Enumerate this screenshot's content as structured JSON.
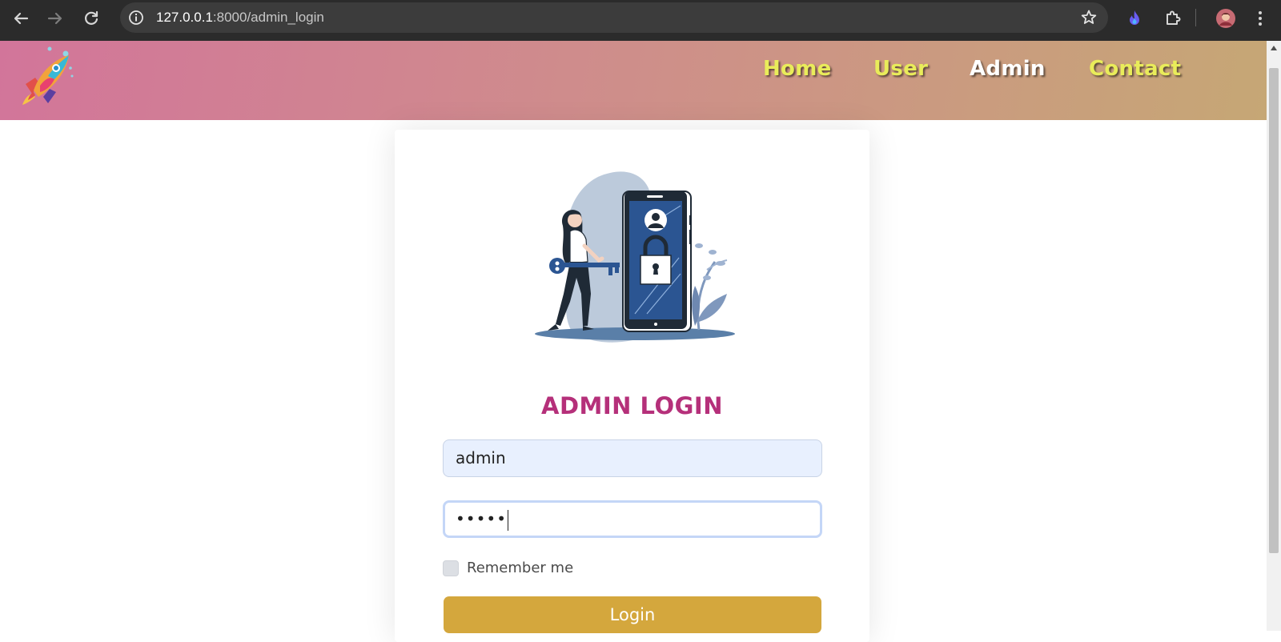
{
  "browser": {
    "url_host": "127.0.0.1",
    "url_path": ":8000/admin_login"
  },
  "header": {
    "logo": "rocket-logo",
    "nav": [
      {
        "label": "Home",
        "active": false
      },
      {
        "label": "User",
        "active": false
      },
      {
        "label": "Admin",
        "active": true
      },
      {
        "label": "Contact",
        "active": false
      }
    ]
  },
  "login": {
    "illustration": "woman-with-key-unlocking-phone",
    "title": "ADMIN LOGIN",
    "username_value": "admin",
    "password_value": "•••••",
    "remember_label": "Remember me",
    "remember_checked": false,
    "button_label": "Login"
  },
  "colors": {
    "header_gradient_start": "#d2759a",
    "header_gradient_end": "#c6a775",
    "nav_yellow": "#e9ec5a",
    "title": "#b5307a",
    "button": "#d4a73d"
  }
}
